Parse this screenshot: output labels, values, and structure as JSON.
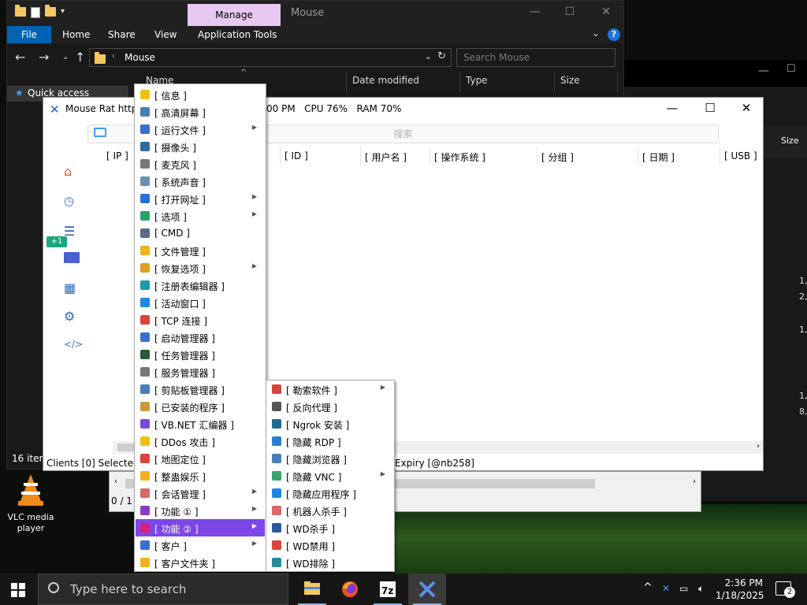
{
  "explorer": {
    "manage_tab": "Manage",
    "title": "Mouse",
    "ribbon": {
      "file": "File",
      "home": "Home",
      "share": "Share",
      "view": "View",
      "app_tools": "Application Tools"
    },
    "address_path": "Mouse",
    "search_placeholder": "Search Mouse",
    "columns": {
      "name": "Name",
      "date_modified": "Date modified",
      "type": "Type",
      "size": "Size"
    },
    "quick_access": "Quick access",
    "status_items": "16 iter"
  },
  "background_window": {
    "size_header": "Size",
    "numbers": [
      "1,",
      "2,",
      "1,",
      "1,",
      "8,"
    ]
  },
  "second_window": {
    "status": "0 / 1 c"
  },
  "rat": {
    "title": "Mouse Rat https",
    "time_fragment": "00 PM",
    "cpu": "CPU 76%",
    "ram": "RAM 70%",
    "search_placeholder": "搜索",
    "side_badge": "+1",
    "columns": {
      "ip": "[ IP ]",
      "id": "[ ID ]",
      "username": "[ 用户名 ]",
      "os": "[ 操作系统 ]",
      "group": "[ 分组 ]",
      "date": "[ 日期 ]",
      "usb": "[ USB ]"
    },
    "status_left": "Clients [0]   Selected [",
    "status_right": "Expiry [@nb258]"
  },
  "main_menu": {
    "items": [
      {
        "label": "[ 信息 ]",
        "icon": "info-icon",
        "color": "#f2c012",
        "submenu": false
      },
      {
        "label": "[ 高清屏幕 ]",
        "icon": "monitor-icon",
        "color": "#4a7fb5",
        "submenu": false
      },
      {
        "label": "[ 运行文件 ]",
        "icon": "run-file-icon",
        "color": "#3a6fcf",
        "submenu": true
      },
      {
        "label": "[ 摄像头 ]",
        "icon": "webcam-icon",
        "color": "#2f6b9a",
        "submenu": false
      },
      {
        "label": "[ 麦克风 ]",
        "icon": "microphone-icon",
        "color": "#777777",
        "submenu": false
      },
      {
        "label": "[ 系统声音 ]",
        "icon": "speaker-icon",
        "color": "#6a8fb5",
        "submenu": false
      },
      {
        "label": "[ 打开网址 ]",
        "icon": "globe-icon",
        "color": "#2a6fd6",
        "submenu": true
      },
      {
        "label": "[ 选项 ]",
        "icon": "options-icon",
        "color": "#2aa36a",
        "submenu": true
      },
      {
        "label": "[ CMD ]",
        "icon": "code-icon",
        "color": "#5a6a8a",
        "submenu": false
      },
      {
        "label": "[ 文件管理 ]",
        "icon": "folder-icon",
        "color": "#f2b21e",
        "submenu": false
      },
      {
        "label": "[ 恢复选项 ]",
        "icon": "wrench-icon",
        "color": "#e0a020",
        "submenu": true
      },
      {
        "label": "[ 注册表编辑器 ]",
        "icon": "registry-icon",
        "color": "#1e9aa8",
        "submenu": false
      },
      {
        "label": "[ 活动窗口 ]",
        "icon": "windows-icon",
        "color": "#1e88e5",
        "submenu": false
      },
      {
        "label": "[ TCP 连接 ]",
        "icon": "network-globe-icon",
        "color": "#d8453a",
        "submenu": false
      },
      {
        "label": "[ 启动管理器 ]",
        "icon": "startup-icon",
        "color": "#3a6fcf",
        "submenu": false
      },
      {
        "label": "[ 任务管理器 ]",
        "icon": "task-manager-icon",
        "color": "#2a5a3a",
        "submenu": false
      },
      {
        "label": "[ 服务管理器 ]",
        "icon": "gears-icon",
        "color": "#777777",
        "submenu": false
      },
      {
        "label": "[ 剪贴板管理器 ]",
        "icon": "clipboard-icon",
        "color": "#4a7fb5",
        "submenu": false
      },
      {
        "label": "[ 已安装的程序 ]",
        "icon": "installer-icon",
        "color": "#c89a3a",
        "submenu": false
      },
      {
        "label": "[ VB.NET 汇编器 ]",
        "icon": "visual-studio-icon",
        "color": "#7a4ad8",
        "submenu": false
      },
      {
        "label": "[ DDos 攻击 ]",
        "icon": "lightning-icon",
        "color": "#f2c012",
        "submenu": false
      },
      {
        "label": "[ 地图定位 ]",
        "icon": "map-pin-icon",
        "color": "#d8453a",
        "submenu": false
      },
      {
        "label": "[ 整蛊娱乐 ]",
        "icon": "crown-icon",
        "color": "#f2b21e",
        "submenu": false
      },
      {
        "label": "[ 会话管理 ]",
        "icon": "session-icon",
        "color": "#d86a6a",
        "submenu": true
      },
      {
        "label": "[ 功能 ① ]",
        "icon": "plus-icon",
        "color": "#8a3ac8",
        "submenu": true
      },
      {
        "label": "[ 功能 ② ]",
        "icon": "plus-icon",
        "color": "#d81e7a",
        "submenu": true,
        "highlighted": true
      },
      {
        "label": "[ 客户 ]",
        "icon": "client-gears-icon",
        "color": "#3a6fcf",
        "submenu": true
      },
      {
        "label": "[ 客户文件夹 ]",
        "icon": "client-folder-icon",
        "color": "#f2b21e",
        "submenu": false
      }
    ]
  },
  "sub_menu": {
    "items": [
      {
        "label": "[ 勒索软件 ]",
        "icon": "ransomware-icon",
        "color": "#d8453a",
        "submenu": true
      },
      {
        "label": "[ 反向代理 ]",
        "icon": "proxy-icon",
        "color": "#555555",
        "submenu": false
      },
      {
        "label": "[ Ngrok 安装 ]",
        "icon": "ngrok-icon",
        "color": "#1e6a8a",
        "submenu": false
      },
      {
        "label": "[ 隐藏 RDP ]",
        "icon": "rdp-icon",
        "color": "#2a7fcf",
        "submenu": false
      },
      {
        "label": "[ 隐藏浏览器 ]",
        "icon": "browser-icon",
        "color": "#4a7fb5",
        "submenu": false
      },
      {
        "label": "[ 隐藏 VNC ]",
        "icon": "vnc-icon",
        "color": "#3aa36a",
        "submenu": true
      },
      {
        "label": "[ 隐藏应用程序 ]",
        "icon": "cube-icon",
        "color": "#1e88e5",
        "submenu": false
      },
      {
        "label": "[ 机器人杀手 ]",
        "icon": "bot-killer-icon",
        "color": "#d86a6a",
        "submenu": false
      },
      {
        "label": "[ WD杀手 ]",
        "icon": "wd-killer-icon",
        "color": "#2a5a9a",
        "submenu": false
      },
      {
        "label": "[ WD禁用 ]",
        "icon": "block-icon",
        "color": "#d8453a",
        "submenu": false
      },
      {
        "label": "[ WD排除 ]",
        "icon": "wd-exclude-icon",
        "color": "#2a8a9a",
        "submenu": false
      }
    ]
  },
  "desktop": {
    "vlc_label": "VLC media player"
  },
  "taskbar": {
    "search_placeholder": "Type here to search",
    "time": "2:36 PM",
    "date": "1/18/2025",
    "notification_count": "2"
  }
}
